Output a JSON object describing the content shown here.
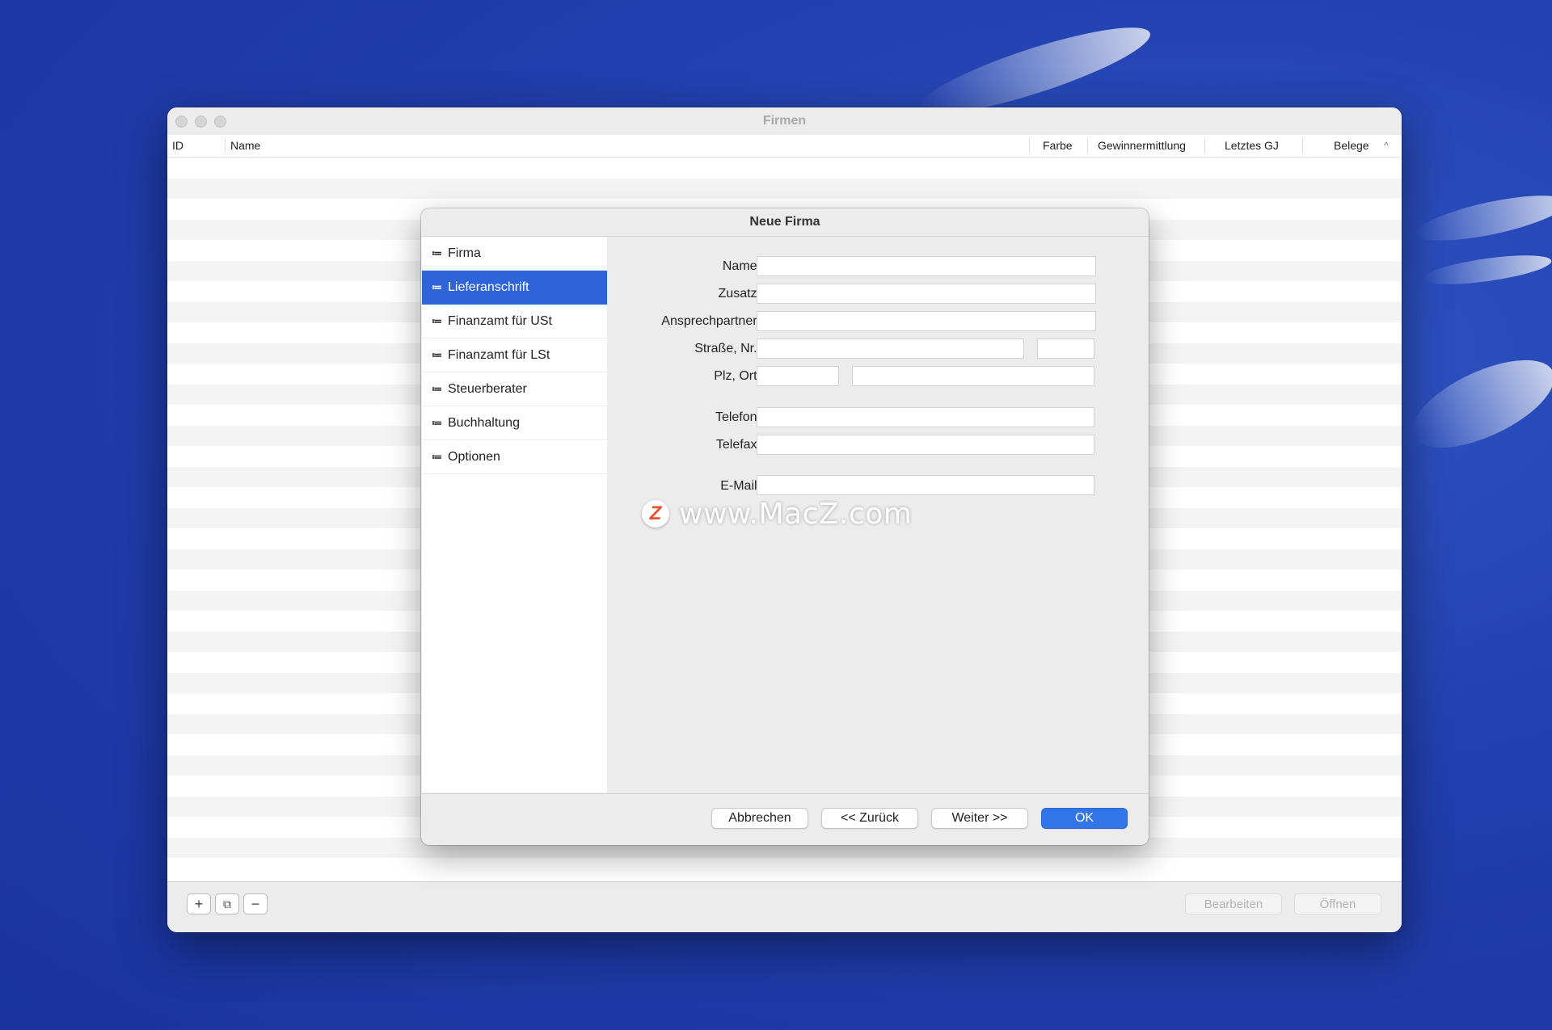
{
  "window": {
    "title": "Firmen",
    "columns": [
      "ID",
      "Name",
      "Farbe",
      "Gewinnermittlung",
      "Letztes GJ",
      "Belege"
    ],
    "sort_indicator": "^",
    "bottom_buttons": {
      "add": "+",
      "duplicate": "⧉",
      "remove": "−",
      "edit": "Bearbeiten",
      "open": "Öffnen"
    }
  },
  "dialog": {
    "title": "Neue Firma",
    "nav_items": [
      {
        "label": "Firma",
        "active": false
      },
      {
        "label": "Lieferanschrift",
        "active": true
      },
      {
        "label": "Finanzamt für USt",
        "active": false
      },
      {
        "label": "Finanzamt für LSt",
        "active": false
      },
      {
        "label": "Steuerberater",
        "active": false
      },
      {
        "label": "Buchhaltung",
        "active": false
      },
      {
        "label": "Optionen",
        "active": false
      }
    ],
    "nav_icon": "≔",
    "labels": {
      "name": "Name:",
      "zusatz": "Zusatz:",
      "ansprechpartner": "Ansprechpartner:",
      "strasse": "Straße, Nr.:",
      "plz_ort": "Plz, Ort:",
      "telefon": "Telefon:",
      "telefax": "Telefax:",
      "email": "E-Mail:"
    },
    "fields": {
      "name": "",
      "zusatz": "",
      "ansprechpartner": "",
      "strasse": "",
      "hausnr": "",
      "plz": "",
      "ort": "",
      "telefon": "",
      "telefax": "",
      "email": ""
    },
    "buttons": {
      "cancel": "Abbrechen",
      "back": "<< Zurück",
      "next": "Weiter >>",
      "ok": "OK"
    }
  },
  "watermark": {
    "logo": "Z",
    "text": "www.MacZ.com"
  },
  "colors": {
    "accent": "#2f63d8",
    "desktop": "#213fae",
    "ok_button": "#3275e8"
  }
}
